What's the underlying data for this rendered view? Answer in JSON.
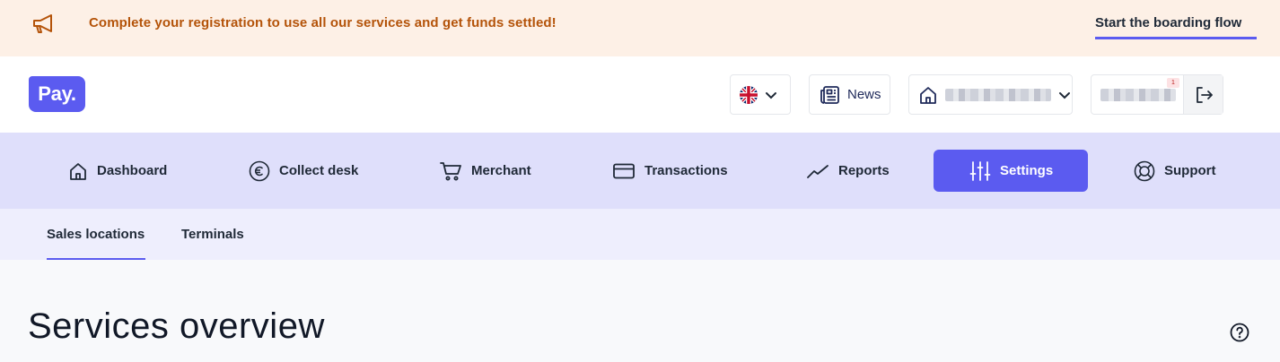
{
  "banner": {
    "message": "Complete your registration to use all our services and get funds settled!",
    "cta": "Start the boarding flow",
    "icon": "megaphone-icon"
  },
  "header": {
    "logo": "Pay.",
    "language_icon": "uk-flag-icon",
    "news_label": "News",
    "notification_badge": "1"
  },
  "nav": {
    "items": [
      {
        "label": "Dashboard",
        "icon": "home-icon"
      },
      {
        "label": "Collect desk",
        "icon": "euro-icon"
      },
      {
        "label": "Merchant",
        "icon": "cart-icon"
      },
      {
        "label": "Transactions",
        "icon": "card-icon"
      },
      {
        "label": "Reports",
        "icon": "trend-icon"
      },
      {
        "label": "Settings",
        "icon": "sliders-icon",
        "active": true
      },
      {
        "label": "Support",
        "icon": "lifebuoy-icon"
      }
    ]
  },
  "subnav": {
    "items": [
      {
        "label": "Sales locations",
        "active": true
      },
      {
        "label": "Terminals"
      }
    ]
  },
  "page": {
    "title": "Services overview",
    "help_icon": "help-icon"
  },
  "colors": {
    "accent": "#5b5bf0",
    "banner_bg": "#fdf0e6",
    "banner_text": "#b45309",
    "nav_bg": "#dfdffb",
    "subnav_bg": "#eeeefd"
  }
}
